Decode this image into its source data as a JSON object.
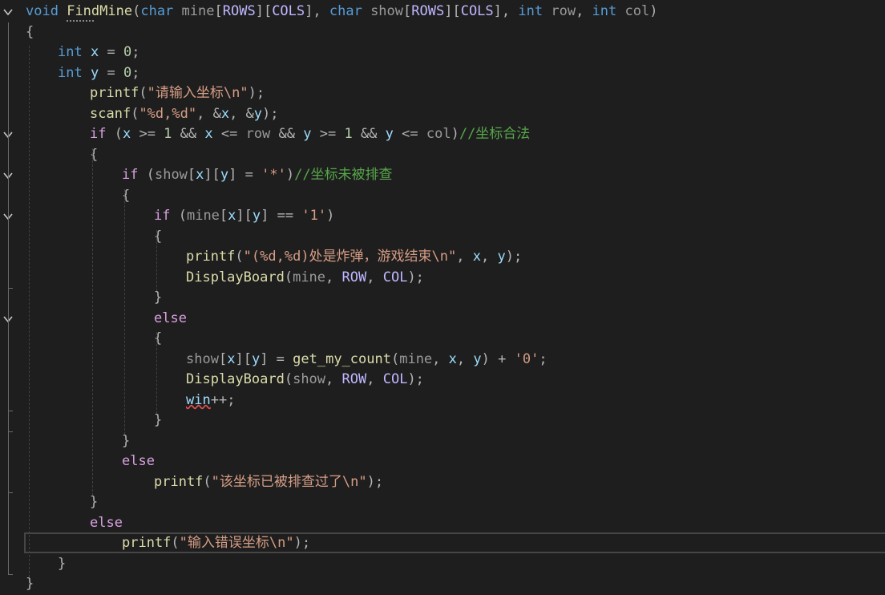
{
  "editor": {
    "language": "C",
    "lines": [
      {
        "tokens": [
          [
            "kw",
            "void"
          ],
          [
            "plain",
            " "
          ],
          [
            "fn",
            "FindMine"
          ],
          [
            "plain",
            "("
          ],
          [
            "kw",
            "char"
          ],
          [
            "plain",
            " "
          ],
          [
            "param",
            "mine"
          ],
          [
            "plain",
            "["
          ],
          [
            "macro",
            "ROWS"
          ],
          [
            "plain",
            "]["
          ],
          [
            "macro",
            "COLS"
          ],
          [
            "plain",
            "], "
          ],
          [
            "kw",
            "char"
          ],
          [
            "plain",
            " "
          ],
          [
            "param",
            "show"
          ],
          [
            "plain",
            "["
          ],
          [
            "macro",
            "ROWS"
          ],
          [
            "plain",
            "]["
          ],
          [
            "macro",
            "COLS"
          ],
          [
            "plain",
            "], "
          ],
          [
            "kw",
            "int"
          ],
          [
            "plain",
            " "
          ],
          [
            "param",
            "row"
          ],
          [
            "plain",
            ", "
          ],
          [
            "kw",
            "int"
          ],
          [
            "plain",
            " "
          ],
          [
            "param",
            "col"
          ],
          [
            "plain",
            ")"
          ]
        ]
      },
      {
        "tokens": [
          [
            "plain",
            "{"
          ]
        ]
      },
      {
        "tokens": [
          [
            "kw",
            "int"
          ],
          [
            "plain",
            " "
          ],
          [
            "var",
            "x"
          ],
          [
            "plain",
            " = "
          ],
          [
            "num",
            "0"
          ],
          [
            "plain",
            ";"
          ]
        ]
      },
      {
        "tokens": [
          [
            "kw",
            "int"
          ],
          [
            "plain",
            " "
          ],
          [
            "var",
            "y"
          ],
          [
            "plain",
            " = "
          ],
          [
            "num",
            "0"
          ],
          [
            "plain",
            ";"
          ]
        ]
      },
      {
        "tokens": [
          [
            "fn",
            "printf"
          ],
          [
            "plain",
            "("
          ],
          [
            "str",
            "\"请输入坐标\\n\""
          ],
          [
            "plain",
            ");"
          ]
        ]
      },
      {
        "tokens": [
          [
            "fn",
            "scanf"
          ],
          [
            "plain",
            "("
          ],
          [
            "str",
            "\"%d,%d\""
          ],
          [
            "plain",
            ", &"
          ],
          [
            "var",
            "x"
          ],
          [
            "plain",
            ", &"
          ],
          [
            "var",
            "y"
          ],
          [
            "plain",
            ");"
          ]
        ]
      },
      {
        "tokens": [
          [
            "ctl",
            "if"
          ],
          [
            "plain",
            " ("
          ],
          [
            "var",
            "x"
          ],
          [
            "plain",
            " >= "
          ],
          [
            "num",
            "1"
          ],
          [
            "plain",
            " && "
          ],
          [
            "var",
            "x"
          ],
          [
            "plain",
            " <= "
          ],
          [
            "param",
            "row"
          ],
          [
            "plain",
            " && "
          ],
          [
            "var",
            "y"
          ],
          [
            "plain",
            " >= "
          ],
          [
            "num",
            "1"
          ],
          [
            "plain",
            " && "
          ],
          [
            "var",
            "y"
          ],
          [
            "plain",
            " <= "
          ],
          [
            "param",
            "col"
          ],
          [
            "plain",
            ")"
          ],
          [
            "cmt",
            "//坐标合法"
          ]
        ]
      },
      {
        "tokens": [
          [
            "plain",
            "{"
          ]
        ]
      },
      {
        "tokens": [
          [
            "ctl",
            "if"
          ],
          [
            "plain",
            " ("
          ],
          [
            "param",
            "show"
          ],
          [
            "plain",
            "["
          ],
          [
            "var",
            "x"
          ],
          [
            "plain",
            "]["
          ],
          [
            "var",
            "y"
          ],
          [
            "plain",
            "] = "
          ],
          [
            "str",
            "'*'"
          ],
          [
            "plain",
            ")"
          ],
          [
            "cmt",
            "//坐标未被排查"
          ]
        ]
      },
      {
        "tokens": [
          [
            "plain",
            "{"
          ]
        ]
      },
      {
        "tokens": [
          [
            "ctl",
            "if"
          ],
          [
            "plain",
            " ("
          ],
          [
            "param",
            "mine"
          ],
          [
            "plain",
            "["
          ],
          [
            "var",
            "x"
          ],
          [
            "plain",
            "]["
          ],
          [
            "var",
            "y"
          ],
          [
            "plain",
            "] == "
          ],
          [
            "str",
            "'1'"
          ],
          [
            "plain",
            ")"
          ]
        ]
      },
      {
        "tokens": [
          [
            "plain",
            "{"
          ]
        ]
      },
      {
        "tokens": [
          [
            "fn",
            "printf"
          ],
          [
            "plain",
            "("
          ],
          [
            "str",
            "\"(%d,%d)处是炸弹，游戏结束\\n\""
          ],
          [
            "plain",
            ", "
          ],
          [
            "var",
            "x"
          ],
          [
            "plain",
            ", "
          ],
          [
            "var",
            "y"
          ],
          [
            "plain",
            ");"
          ]
        ]
      },
      {
        "tokens": [
          [
            "fn",
            "DisplayBoard"
          ],
          [
            "plain",
            "("
          ],
          [
            "param",
            "mine"
          ],
          [
            "plain",
            ", "
          ],
          [
            "macro",
            "ROW"
          ],
          [
            "plain",
            ", "
          ],
          [
            "macro",
            "COL"
          ],
          [
            "plain",
            ");"
          ]
        ]
      },
      {
        "tokens": [
          [
            "plain",
            "}"
          ]
        ]
      },
      {
        "tokens": [
          [
            "ctl",
            "else"
          ]
        ]
      },
      {
        "tokens": [
          [
            "plain",
            "{"
          ]
        ]
      },
      {
        "tokens": [
          [
            "param",
            "show"
          ],
          [
            "plain",
            "["
          ],
          [
            "var",
            "x"
          ],
          [
            "plain",
            "]["
          ],
          [
            "var",
            "y"
          ],
          [
            "plain",
            "] = "
          ],
          [
            "fn",
            "get_my_count"
          ],
          [
            "plain",
            "("
          ],
          [
            "param",
            "mine"
          ],
          [
            "plain",
            ", "
          ],
          [
            "var",
            "x"
          ],
          [
            "plain",
            ", "
          ],
          [
            "var",
            "y"
          ],
          [
            "plain",
            ") + "
          ],
          [
            "str",
            "'0'"
          ],
          [
            "plain",
            ";"
          ]
        ]
      },
      {
        "tokens": [
          [
            "fn",
            "DisplayBoard"
          ],
          [
            "plain",
            "("
          ],
          [
            "param",
            "show"
          ],
          [
            "plain",
            ", "
          ],
          [
            "macro",
            "ROW"
          ],
          [
            "plain",
            ", "
          ],
          [
            "macro",
            "COL"
          ],
          [
            "plain",
            ");"
          ]
        ]
      },
      {
        "tokens": [
          [
            "var",
            "win"
          ],
          [
            "plain",
            "++;"
          ]
        ]
      },
      {
        "tokens": [
          [
            "plain",
            "}"
          ]
        ]
      },
      {
        "tokens": [
          [
            "plain",
            "}"
          ]
        ]
      },
      {
        "tokens": [
          [
            "ctl",
            "else"
          ]
        ]
      },
      {
        "tokens": [
          [
            "fn",
            "printf"
          ],
          [
            "plain",
            "("
          ],
          [
            "str",
            "\"该坐标已被排查过了\\n\""
          ],
          [
            "plain",
            ");"
          ]
        ]
      },
      {
        "tokens": [
          [
            "plain",
            "}"
          ]
        ]
      },
      {
        "tokens": [
          [
            "ctl",
            "else"
          ]
        ]
      },
      {
        "tokens": [
          [
            "fn",
            "printf"
          ],
          [
            "plain",
            "("
          ],
          [
            "str",
            "\"输入错误坐标\\n\""
          ],
          [
            "plain",
            ");"
          ]
        ]
      },
      {
        "tokens": [
          [
            "plain",
            "}"
          ]
        ]
      },
      {
        "tokens": [
          [
            "plain",
            "}"
          ]
        ]
      }
    ]
  }
}
